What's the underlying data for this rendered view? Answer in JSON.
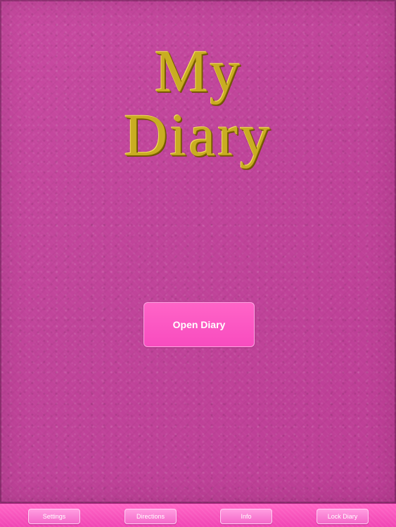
{
  "cover": {
    "title_line_1": "My",
    "title_line_2": "Diary",
    "open_button_label": "Open Diary"
  },
  "toolbar": {
    "buttons": [
      {
        "label": "Settings"
      },
      {
        "label": "Directions"
      },
      {
        "label": "Info"
      },
      {
        "label": "Lock Diary"
      }
    ]
  },
  "colors": {
    "cover_pink": "#c0449a",
    "title_gold": "#c9ad22",
    "button_pink": "#f84cbf",
    "toolbar_pink": "#f044b4"
  }
}
